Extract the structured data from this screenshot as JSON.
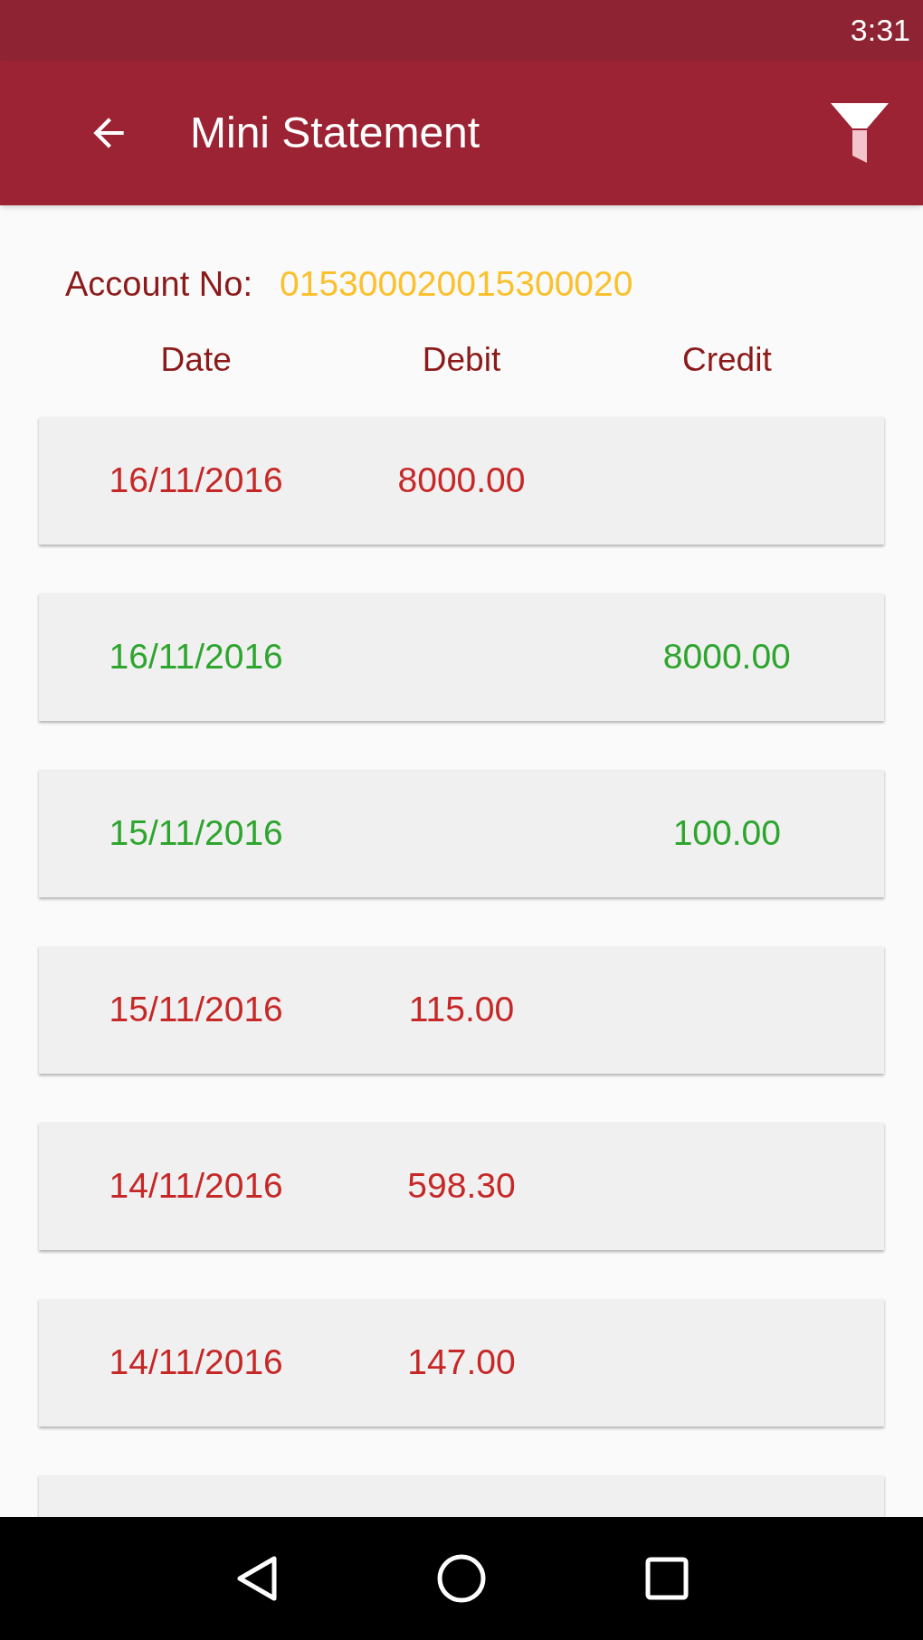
{
  "status_bar": {
    "time": "3:31"
  },
  "app_bar": {
    "title": "Mini Statement"
  },
  "account": {
    "label": "Account No:",
    "number": "015300020015300020"
  },
  "columns": [
    "Date",
    "Debit",
    "Credit"
  ],
  "rows": [
    {
      "kind": "debit",
      "date": "16/11/2016",
      "amount": "8000.00"
    },
    {
      "kind": "credit",
      "date": "16/11/2016",
      "amount": "8000.00"
    },
    {
      "kind": "credit",
      "date": "15/11/2016",
      "amount": "100.00"
    },
    {
      "kind": "debit",
      "date": "15/11/2016",
      "amount": "115.00"
    },
    {
      "kind": "debit",
      "date": "14/11/2016",
      "amount": "598.30"
    },
    {
      "kind": "debit",
      "date": "14/11/2016",
      "amount": "147.00"
    }
  ]
}
